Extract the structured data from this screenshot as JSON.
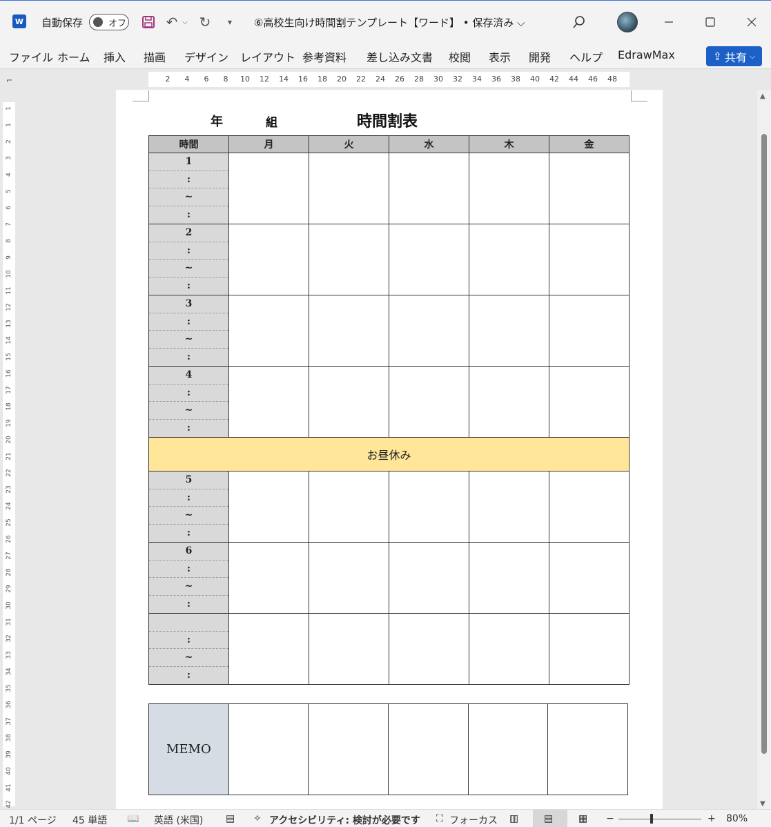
{
  "titlebar": {
    "app_icon": "word-icon",
    "autosave_label": "自動保存",
    "autosave_state": "オフ",
    "document_title": "⑥高校生向け時間割テンプレート【ワード】 • 保存済み ⌵"
  },
  "ribbon": {
    "tabs": [
      "ファイル",
      "ホーム",
      "挿入",
      "描画",
      "デザイン",
      "レイアウト",
      "参考資料",
      "差し込み文書",
      "校閲",
      "表示",
      "開発",
      "ヘルプ",
      "EdrawMax"
    ],
    "share_label": "共有"
  },
  "ruler": {
    "numbers": [
      "2",
      "4",
      "6",
      "8",
      "10",
      "12",
      "14",
      "16",
      "18",
      "20",
      "22",
      "24",
      "26",
      "28",
      "30",
      "32",
      "34",
      "36",
      "38",
      "40",
      "42",
      "44",
      "46",
      "48"
    ],
    "vertical": [
      "1",
      "1",
      "2",
      "3",
      "4",
      "5",
      "6",
      "7",
      "8",
      "9",
      "10",
      "11",
      "12",
      "13",
      "14",
      "15",
      "16",
      "17",
      "18",
      "19",
      "20",
      "21",
      "22",
      "23",
      "24",
      "25",
      "26",
      "27",
      "28",
      "29",
      "30",
      "31",
      "32",
      "33",
      "34",
      "35",
      "36",
      "37",
      "38",
      "39",
      "40",
      "41",
      "42"
    ]
  },
  "document": {
    "year_label": "年",
    "class_label": "組",
    "title": "時間割表",
    "timetable": {
      "headers": [
        "時間",
        "月",
        "火",
        "水",
        "木",
        "金"
      ],
      "periods_before_lunch": [
        {
          "num": "1",
          "slots": [
            "1",
            ":",
            "~",
            ":"
          ]
        },
        {
          "num": "2",
          "slots": [
            "2",
            ":",
            "~",
            ":"
          ]
        },
        {
          "num": "3",
          "slots": [
            "3",
            ":",
            "~",
            ":"
          ]
        },
        {
          "num": "4",
          "slots": [
            "4",
            ":",
            "~",
            ":"
          ]
        }
      ],
      "lunch": "お昼休み",
      "periods_after_lunch": [
        {
          "num": "5",
          "slots": [
            "5",
            ":",
            "~",
            ":"
          ]
        },
        {
          "num": "6",
          "slots": [
            "6",
            ":",
            "~",
            ":"
          ]
        },
        {
          "num": "",
          "slots": [
            "",
            ":",
            "~",
            ":"
          ]
        }
      ]
    },
    "memo_label": "MEMO"
  },
  "statusbar": {
    "page": "1/1 ページ",
    "words": "45 単語",
    "language": "英語 (米国)",
    "accessibility": "アクセシビリティ: 検討が必要です",
    "focus": "フォーカス",
    "zoom_minus": "−",
    "zoom_plus": "+",
    "zoom": "80%"
  }
}
